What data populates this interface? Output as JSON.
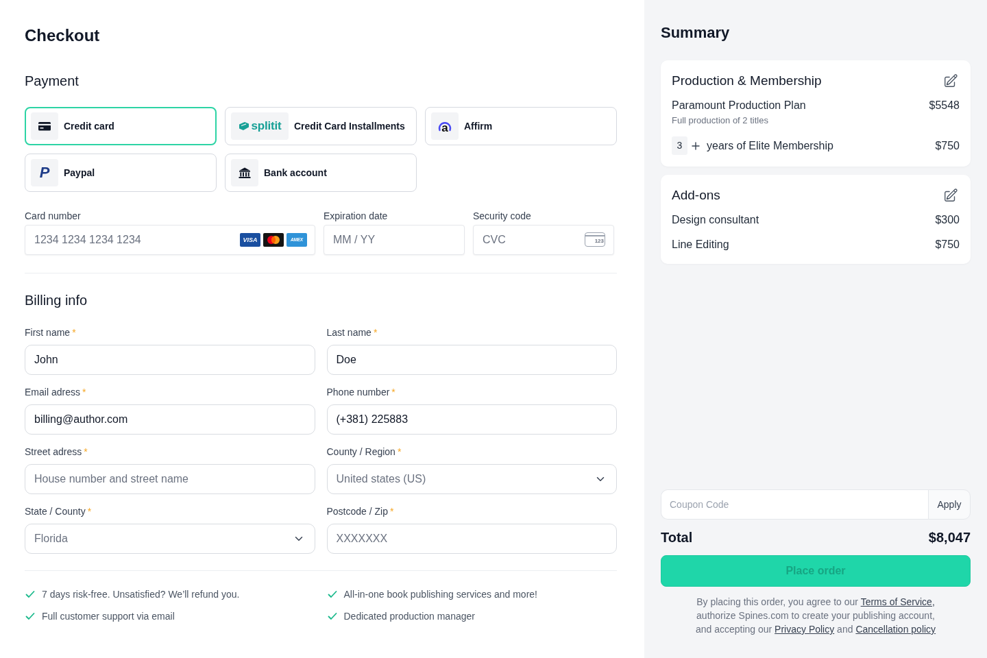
{
  "page": {
    "title": "Checkout"
  },
  "payment": {
    "heading": "Payment",
    "methods": [
      {
        "kind": "card",
        "label": "Credit card",
        "selected": true
      },
      {
        "kind": "splitit",
        "logo_text": "splitit",
        "label": "Credit Card Installments",
        "selected": false
      },
      {
        "kind": "affirm",
        "logo_text": "a",
        "label": "Affirm",
        "selected": false
      },
      {
        "kind": "paypal",
        "logo_text": "P",
        "label": "Paypal",
        "selected": false
      },
      {
        "kind": "bank",
        "label": "Bank account",
        "selected": false
      }
    ],
    "card_fields": [
      {
        "kind": "card_number",
        "label": "Card number",
        "placeholder": "1234 1234 1234 1234",
        "brands": [
          {
            "kind": "visa",
            "label": "VISA"
          },
          {
            "kind": "mastercard"
          },
          {
            "kind": "amex",
            "label": "AMEX"
          }
        ]
      },
      {
        "kind": "expiry",
        "label": "Expiration date",
        "placeholder": "MM / YY"
      },
      {
        "kind": "cvc",
        "label": "Security code",
        "placeholder": "CVC",
        "hint": "123"
      }
    ]
  },
  "billing": {
    "heading": "Billing info",
    "fields": [
      {
        "kind": "text",
        "label": "First name",
        "required_mark": "*",
        "value": "John"
      },
      {
        "kind": "text",
        "label": "Last name",
        "required_mark": "*",
        "value": "Doe"
      },
      {
        "kind": "text",
        "label": "Email adress",
        "required_mark": "*",
        "value": "billing@author.com"
      },
      {
        "kind": "text",
        "label": "Phone number",
        "required_mark": "*",
        "value": "(+381) 225883"
      },
      {
        "kind": "text",
        "label": "Street adress",
        "required_mark": "*",
        "placeholder": "House number and street name"
      },
      {
        "kind": "select",
        "label": "County / Region",
        "required_mark": "*",
        "value": "United states (US)"
      },
      {
        "kind": "select",
        "label": "State / County",
        "required_mark": "*",
        "value": "Florida"
      },
      {
        "kind": "text",
        "label": "Postcode / Zip",
        "required_mark": "*",
        "placeholder": "XXXXXXX"
      }
    ]
  },
  "features": [
    "7 days risk-free. Unsatisfied? We’ll refund you.",
    "All-in-one book publishing services and more!",
    "Full customer support via email",
    "Dedicated production manager"
  ],
  "summary": {
    "title": "Summary",
    "sections": [
      {
        "title": "Production & Membership",
        "items": [
          {
            "kind": "plan",
            "name": "Paramount Production Plan",
            "note": "Full production of 2 titles",
            "price": "$5548"
          },
          {
            "kind": "quantity",
            "quantity": "3",
            "name": "years of Elite Membership",
            "price": "$750"
          }
        ]
      },
      {
        "title": "Add-ons",
        "items": [
          {
            "kind": "line",
            "name": "Design consultant",
            "price": "$300"
          },
          {
            "kind": "line",
            "name": "Line Editing",
            "price": "$750"
          }
        ]
      }
    ],
    "coupon": {
      "placeholder": "Coupon Code",
      "button": "Apply"
    },
    "total": {
      "label": "Total",
      "amount": "$8,047"
    },
    "place_order": {
      "label": "Place order",
      "disabled": true
    },
    "legal": [
      {
        "kind": "text",
        "text": "By placing this order, you agree to our "
      },
      {
        "kind": "link",
        "text": "Terms of Service,"
      },
      {
        "kind": "text",
        "text": " authorize Spines.com to create your publishing account, and accepting our "
      },
      {
        "kind": "link",
        "text": "Privacy Policy"
      },
      {
        "kind": "text",
        "text": " and "
      },
      {
        "kind": "link",
        "text": "Cancellation policy"
      }
    ]
  }
}
